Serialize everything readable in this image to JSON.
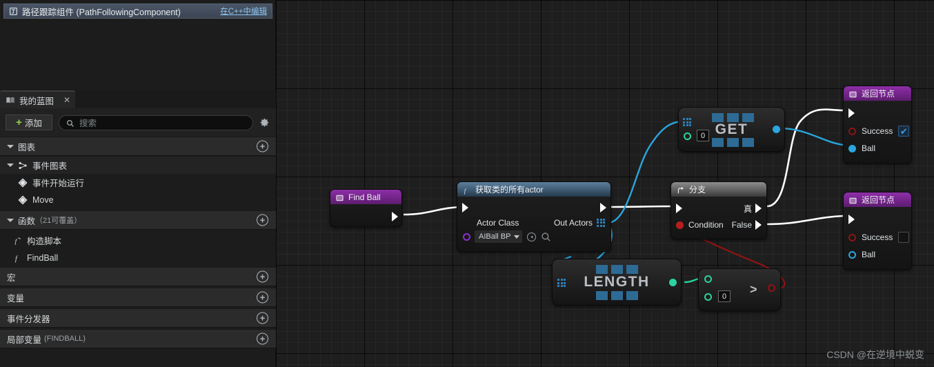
{
  "component_row": {
    "icon": "component-icon",
    "label": "路径跟踪组件 (PathFollowingComponent)",
    "edit_link": "在C++中编辑"
  },
  "tab": {
    "icon": "blueprint-icon",
    "label": "我的蓝图",
    "close": "✕"
  },
  "toolbar": {
    "add_label": "添加",
    "add_plus": "+",
    "search_placeholder": "搜索",
    "settings_icon": "gear-icon"
  },
  "tree": [
    {
      "type": "section",
      "label": "图表",
      "suffix": "",
      "add": "+"
    },
    {
      "type": "group",
      "label": "事件图表",
      "icon": "event-graph-icon"
    },
    {
      "type": "leaf",
      "label": "事件开始运行",
      "icon": "event-diamond-icon"
    },
    {
      "type": "leaf",
      "label": "Move",
      "icon": "event-diamond-icon"
    },
    {
      "type": "section",
      "label": "函数",
      "suffix": "（21可覆盖）",
      "add": "+"
    },
    {
      "type": "leaf",
      "label": "构造脚本",
      "icon": "construction-script-icon"
    },
    {
      "type": "leaf",
      "label": "FindBall",
      "icon": "function-icon"
    },
    {
      "type": "section",
      "label": "宏",
      "suffix": "",
      "add": "+"
    },
    {
      "type": "section",
      "label": "变量",
      "suffix": "",
      "add": "+"
    },
    {
      "type": "section",
      "label": "事件分发器",
      "suffix": "",
      "add": "+"
    },
    {
      "type": "section",
      "label": "局部变量",
      "suffix": "(FINDBALL)",
      "add": "+"
    }
  ],
  "graph": {
    "nodes": {
      "find_ball": {
        "title": "Find Ball",
        "title_icon": "function-entry-icon",
        "exec_out": "exec-out-pin"
      },
      "get_all_actors": {
        "title": "获取类的所有actor",
        "title_icon": "function-icon",
        "input_label": "Actor Class",
        "input_value": "AIBall BP",
        "output_label": "Out Actors",
        "browse_icon": "browse-icon",
        "search_icon": "search-icon"
      },
      "get_array_item": {
        "word": "GET",
        "index_value": "0",
        "array_pin": "array-pin",
        "index_pin": "index-pin",
        "out_pin": "object-out-pin"
      },
      "branch": {
        "title": "分支",
        "title_icon": "branch-icon",
        "condition_label": "Condition",
        "true_label": "真",
        "false_label": "False"
      },
      "length": {
        "word": "LENGTH",
        "array_pin": "array-pin",
        "out_pin": "int-out-pin"
      },
      "greater_than": {
        "symbol": ">",
        "b_value": "0",
        "a_pin": "int-a-pin",
        "b_pin": "int-b-pin",
        "out_pin": "bool-out-pin"
      },
      "return_true": {
        "title": "返回节点",
        "title_icon": "return-icon",
        "success_label": "Success",
        "success_checked": "✔",
        "ball_label": "Ball"
      },
      "return_false": {
        "title": "返回节点",
        "title_icon": "return-icon",
        "success_label": "Success",
        "success_checked": "",
        "ball_label": "Ball"
      }
    },
    "watermark": "CSDN @在逆境中蜕变"
  },
  "colors": {
    "exec_wire": "#ffffff",
    "object_wire": "#2aa6e0",
    "int_wire": "#2ad3a0",
    "bool_wire": "#8e1414",
    "accent_purple": "#8e2ea8",
    "accent_blue": "#5c7f9d"
  }
}
